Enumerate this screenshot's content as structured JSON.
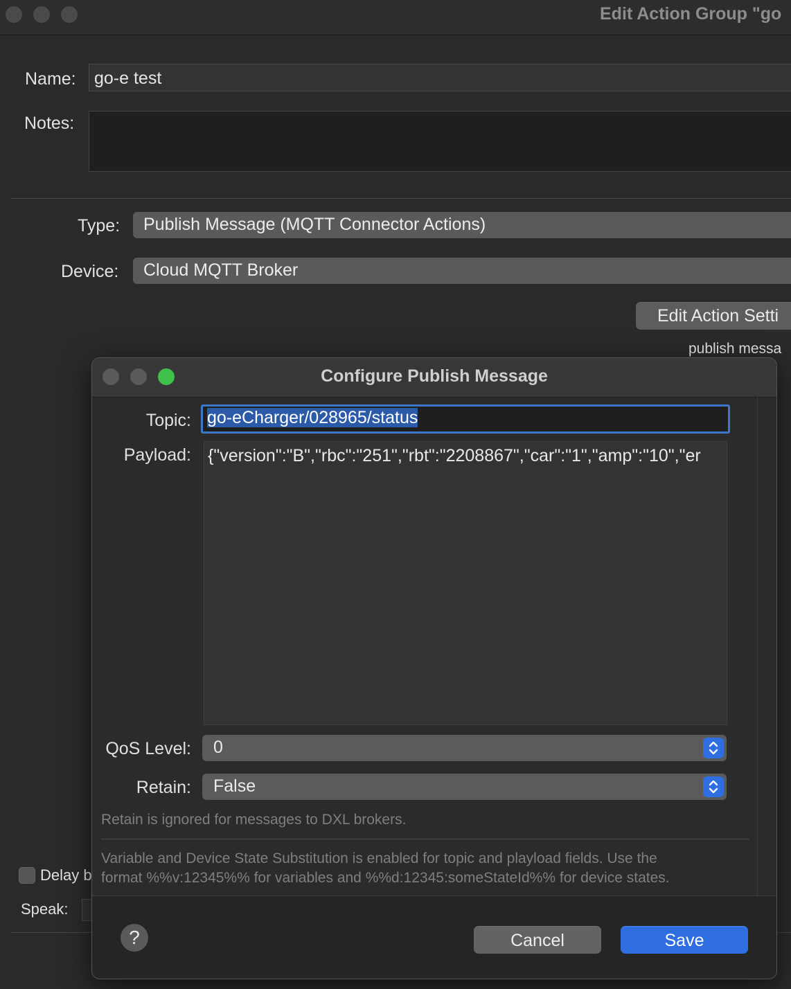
{
  "window": {
    "title": "Edit Action Group \"go"
  },
  "form": {
    "name_label": "Name:",
    "name_value": "go-e test",
    "notes_label": "Notes:",
    "notes_value": "",
    "type_label": "Type:",
    "type_value": "Publish Message (MQTT Connector Actions)",
    "device_label": "Device:",
    "device_value": "Cloud MQTT Broker",
    "edit_action_button": "Edit Action Setti",
    "action_summary": "publish messa",
    "delay_label": "Delay b",
    "speak_label": "Speak:"
  },
  "dialog": {
    "title": "Configure Publish Message",
    "topic_label": "Topic:",
    "topic_value": "go-eCharger/028965/status",
    "payload_label": "Payload:",
    "payload_value": "{\"version\":\"B\",\"rbc\":\"251\",\"rbt\":\"2208867\",\"car\":\"1\",\"amp\":\"10\",\"er",
    "qos_label": "QoS Level:",
    "qos_value": "0",
    "retain_label": "Retain:",
    "retain_value": "False",
    "retain_note": "Retain is ignored for messages to DXL brokers.",
    "substitution_note_line1": "Variable and Device State Substitution is enabled for topic and playload fields. Use the",
    "substitution_note_line2": "format %%v:12345%% for variables and %%d:12345:someStateId%% for device states.",
    "help_label": "?",
    "cancel_label": "Cancel",
    "save_label": "Save"
  },
  "colors": {
    "accent": "#2f6ee0",
    "traffic_close": "#5a5a5a",
    "traffic_zoom": "#3fc24b"
  }
}
